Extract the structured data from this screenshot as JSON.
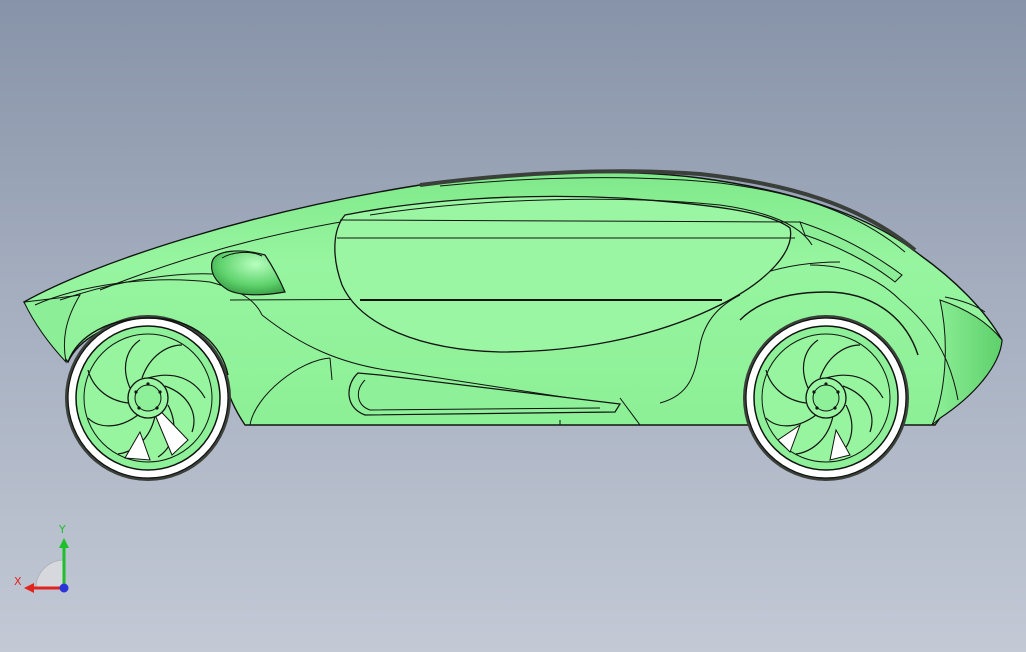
{
  "view": {
    "background_top": "#8793a8",
    "background_bottom": "#c3c9d5",
    "model_color": "#97f5a0",
    "model_shade": "#5fd36d",
    "edge_color": "#101410"
  },
  "triad": {
    "y_label": "Y",
    "x_label": "X",
    "y_color": "#1fbf2a",
    "x_color": "#e0251f",
    "z_color": "#2a34d8"
  }
}
